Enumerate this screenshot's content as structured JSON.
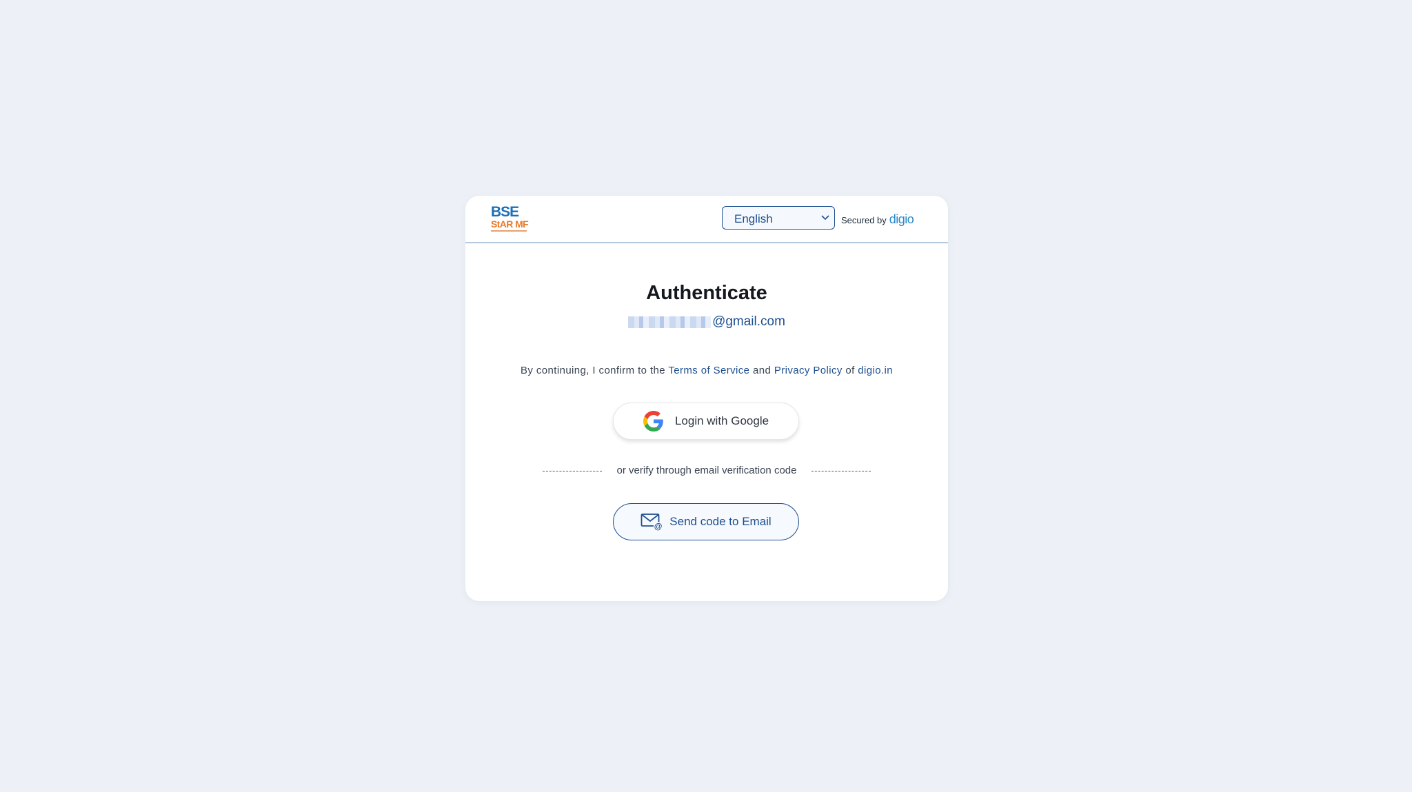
{
  "header": {
    "logo_text": "BSE StAR MF",
    "language": {
      "selected": "English"
    },
    "secured_by_label": "Secured by",
    "secured_by_brand": "digio"
  },
  "main": {
    "title": "Authenticate",
    "email_domain": "@gmail.com",
    "consent": {
      "prefix": "By continuing, I confirm to the",
      "terms_link": "Terms of Service",
      "and": "and",
      "privacy_link": "Privacy Policy",
      "of": "of",
      "site_link": "digio.in"
    },
    "google_button_label": "Login with Google",
    "divider_text": "or verify through email verification code",
    "email_button_label": "Send code to Email"
  },
  "colors": {
    "background": "#edf1f7",
    "accent": "#1d4f91",
    "brand": "#2a88c9"
  },
  "icons": {
    "google": "google-g-icon",
    "email": "email-at-icon",
    "dropdown": "chevron-down-icon"
  }
}
